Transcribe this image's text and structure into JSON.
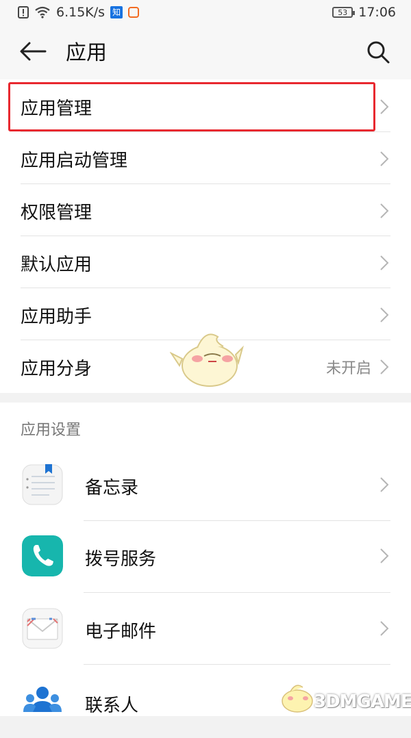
{
  "status_bar": {
    "network_speed": "6.15K/s",
    "app_badge": "知",
    "battery": "53",
    "time": "17:06"
  },
  "header": {
    "title": "应用"
  },
  "menu": {
    "items": [
      {
        "label": "应用管理",
        "value": ""
      },
      {
        "label": "应用启动管理",
        "value": ""
      },
      {
        "label": "权限管理",
        "value": ""
      },
      {
        "label": "默认应用",
        "value": ""
      },
      {
        "label": "应用助手",
        "value": ""
      },
      {
        "label": "应用分身",
        "value": "未开启"
      }
    ]
  },
  "app_settings": {
    "section_title": "应用设置",
    "apps": [
      {
        "label": "备忘录",
        "icon": "memo-icon"
      },
      {
        "label": "拨号服务",
        "icon": "phone-icon"
      },
      {
        "label": "电子邮件",
        "icon": "email-icon"
      },
      {
        "label": "联系人",
        "icon": "contacts-icon"
      }
    ]
  },
  "watermark": {
    "text": "3DMGAME"
  },
  "colors": {
    "highlight": "#e8282f",
    "phone_icon": "#17b6ad",
    "contacts_icon": "#1e73d2"
  }
}
